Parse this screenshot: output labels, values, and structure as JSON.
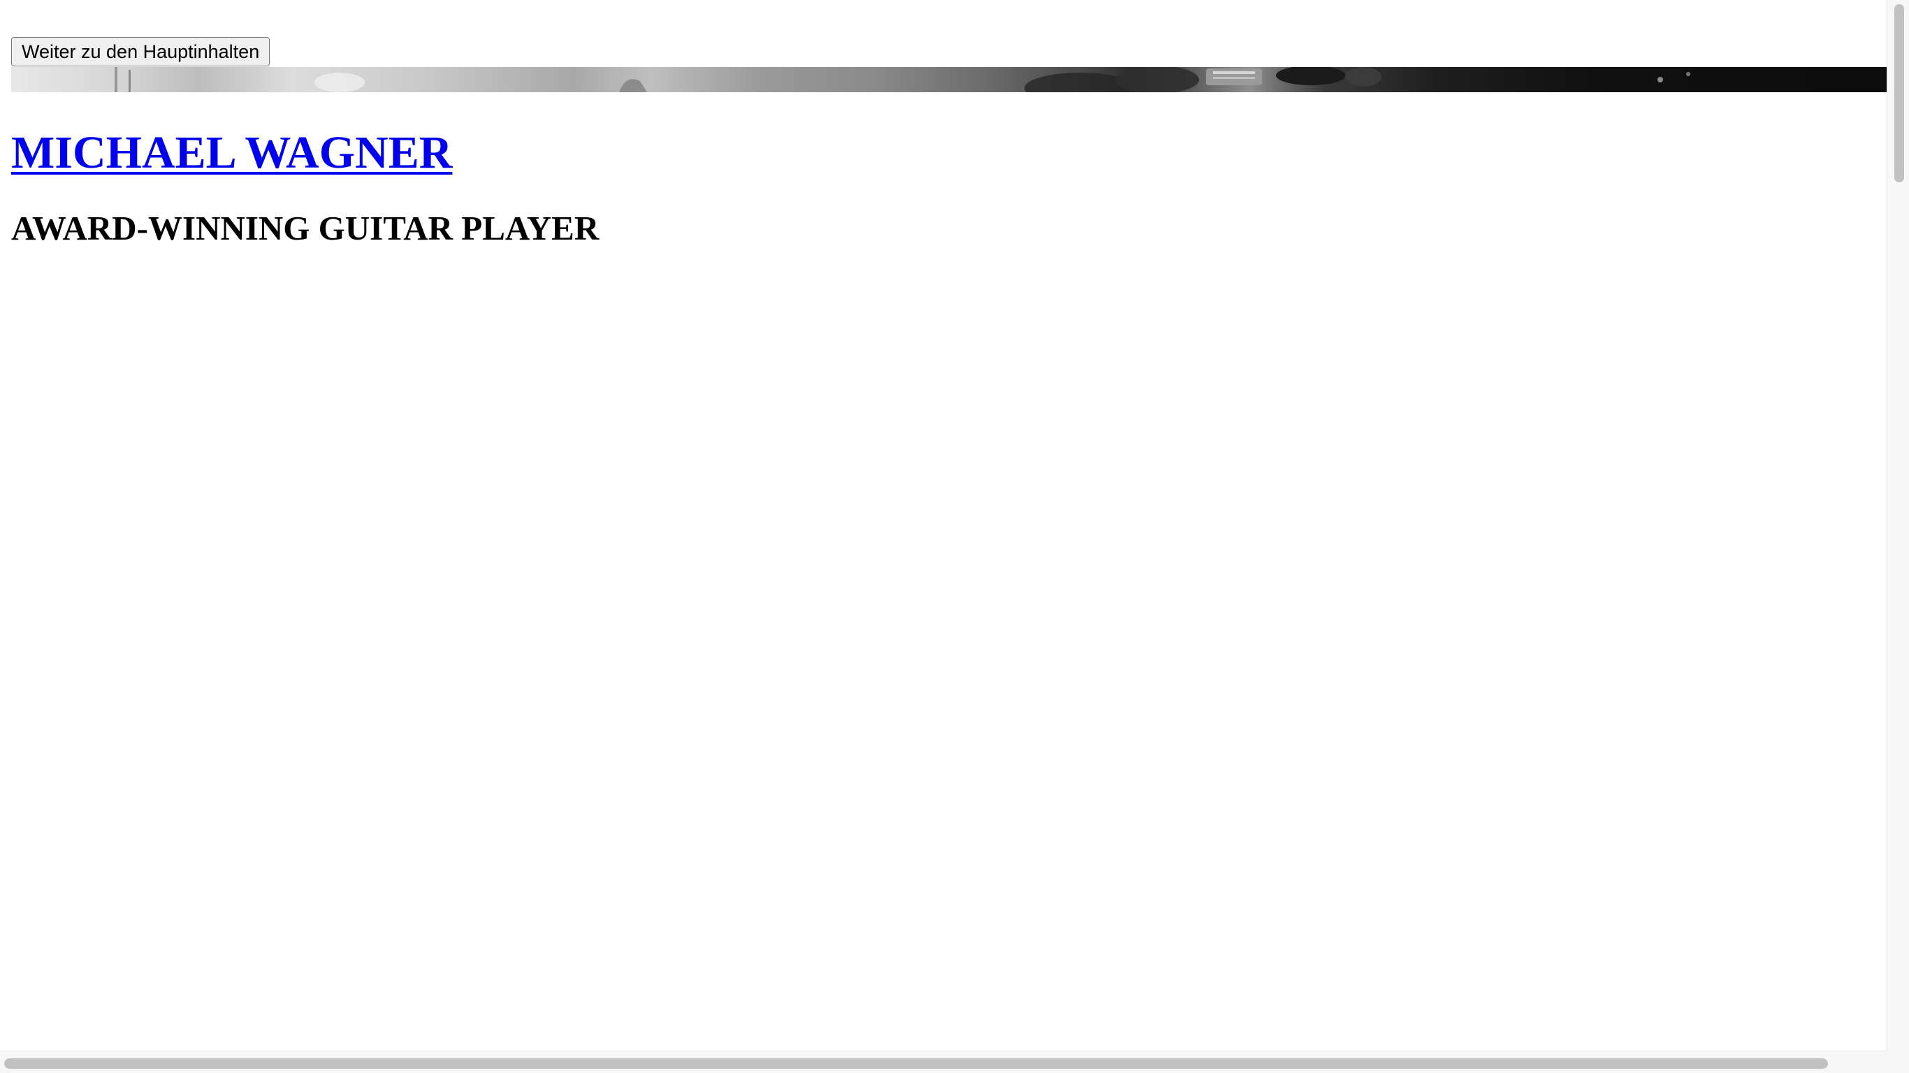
{
  "skip_link": {
    "label": "Weiter zu den Hauptinhalten"
  },
  "header": {
    "hero_image": "guitar-player-photo-banner",
    "site_title": "MICHAEL WAGNER",
    "tagline": "AWARD-WINNING GUITAR PLAYER"
  },
  "colors": {
    "link": "#0000ee",
    "text": "#000000",
    "background": "#ffffff",
    "button_bg": "#efefef",
    "scrollbar_thumb": "#c1c1c1"
  }
}
